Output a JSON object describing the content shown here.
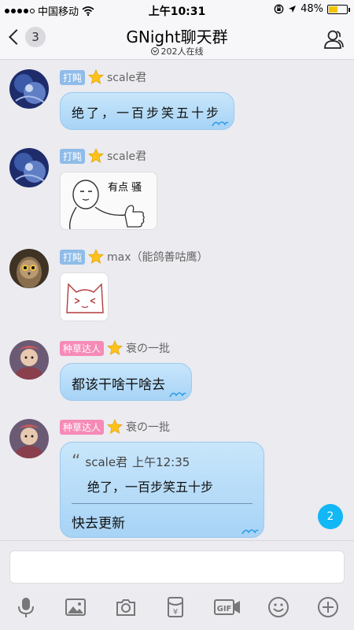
{
  "status_bar": {
    "carrier": "中国移动",
    "time": "上午10:31",
    "battery_percent": "48%",
    "battery_level": 0.48
  },
  "nav": {
    "unread_count": "3",
    "title": "GNight聊天群",
    "online_status": "202人在线"
  },
  "messages": [
    {
      "tag": "打盹",
      "sender": "scale君",
      "text": "绝了，一百步笑五十步"
    },
    {
      "tag": "打盹",
      "sender": "scale君",
      "sticker_caption": "有点 骚"
    },
    {
      "tag": "打盹",
      "sender": "max（能鸽善咕鹰）"
    },
    {
      "tag": "种草达人",
      "sender": "衰の一批",
      "text": "都该干啥干啥去"
    },
    {
      "tag": "种草达人",
      "sender": "衰の一批",
      "quote_author": "scale君",
      "quote_time": "上午12:35",
      "quote_text": "绝了，一百步笑五十步",
      "reply_text": "快去更新"
    }
  ],
  "new_message_count": "2",
  "toolbar": {
    "icons": [
      "microphone-icon",
      "image-icon",
      "camera-icon",
      "red-packet-icon",
      "gif-icon",
      "emoji-icon",
      "plus-icon"
    ]
  }
}
